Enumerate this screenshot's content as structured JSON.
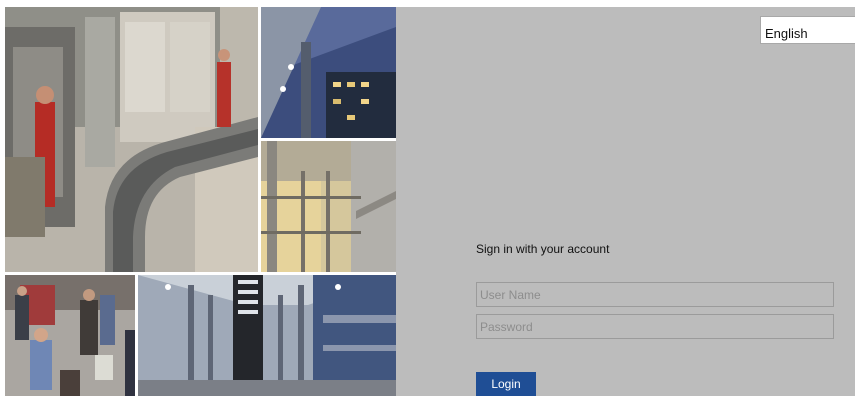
{
  "language_selector": {
    "value": "English"
  },
  "login_form": {
    "heading": "Sign in with your account",
    "username_placeholder": "User Name",
    "password_placeholder": "Password",
    "login_label": "Login"
  },
  "colors": {
    "panel_background": "#bcbcbc",
    "field_border": "#9b9b9b",
    "login_button": "#1f4e95",
    "login_text": "#ffffff"
  }
}
